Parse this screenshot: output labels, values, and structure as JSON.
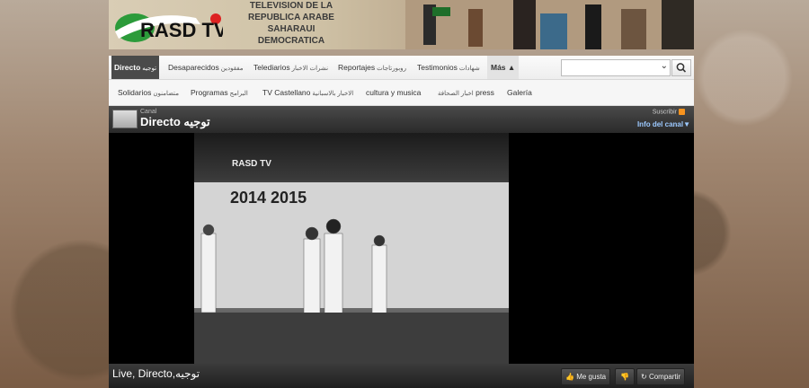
{
  "banner": {
    "logo_text": "RASD TV",
    "title_line1": "TELEVISION DE LA",
    "title_line2": "REPUBLICA ARABE SAHARAUI",
    "title_line3": "DEMOCRATICA"
  },
  "nav": {
    "row1": [
      {
        "label": "Directo",
        "arabic": "توجيه",
        "active": true
      },
      {
        "label": "Desaparecidos",
        "arabic": "مفقودين"
      },
      {
        "label": "Telediarios",
        "arabic": "نشرات الاخبار"
      },
      {
        "label": "Reportajes",
        "arabic": "روبورتاجات"
      },
      {
        "label": "Testimonios",
        "arabic": "شهادات"
      },
      {
        "label": "Más ▲"
      }
    ],
    "row2": [
      {
        "label": "Solidarios",
        "arabic": "متضامنون"
      },
      {
        "label": "Programas",
        "arabic": "البرامج"
      },
      {
        "label": "TV Castellano",
        "arabic": "الاخبار بالاسبانية"
      },
      {
        "label": "cultura y musica"
      },
      {
        "label": "press",
        "arabic": "اخبار الصحافة"
      },
      {
        "label": "Galería"
      }
    ],
    "search_placeholder": ""
  },
  "player": {
    "canal_label": "Canal",
    "channel_title": "Directo توجيه",
    "subscribe": "Suscribir",
    "info": "Info del canal▼",
    "video_caption": "Live, Directo,توجيه",
    "like": "Me gusta",
    "share": "Compartir",
    "frame_overlay": {
      "years": "2014 2015",
      "logo": "RASD TV"
    }
  },
  "colors": {
    "accent_blue": "#9cc9ff",
    "rss": "#f7931e",
    "nav_active": "#4a4a4a"
  }
}
